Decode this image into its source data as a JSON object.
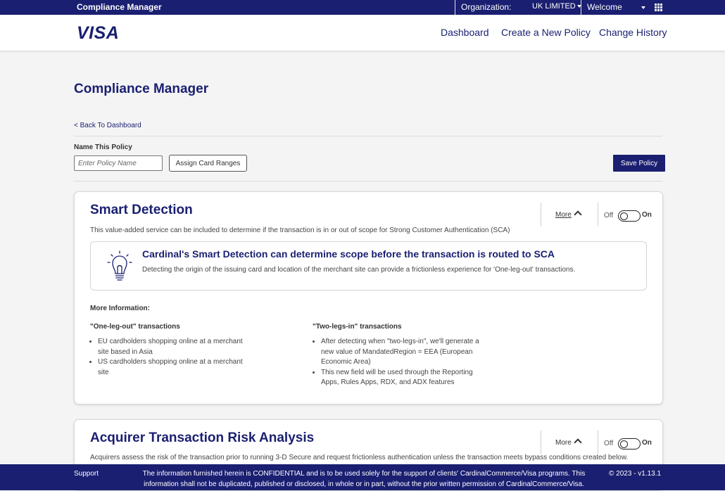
{
  "topbar": {
    "app_title": "Compliance Manager",
    "org_label": "Organization:",
    "org_value": "UK LIMITED",
    "welcome": "Welcome"
  },
  "header": {
    "logo": "VISA",
    "nav": [
      "Dashboard",
      "Create a New Policy",
      "Change History"
    ]
  },
  "page": {
    "title": "Compliance Manager",
    "back_link": "< Back To Dashboard",
    "name_label": "Name This Policy",
    "name_placeholder": "Enter Policy Name",
    "assign_button": "Assign Card Ranges",
    "save_button": "Save Policy"
  },
  "smart_detection": {
    "title": "Smart Detection",
    "description": "This value-added service can be included to determine if the transaction is in or out of scope for Strong Customer Authentication (SCA)",
    "more": "More",
    "toggle_off": "Off",
    "toggle_on": "On",
    "toggle_state": "off",
    "info_heading": "Cardinal's Smart Detection can determine scope before the transaction is routed to SCA",
    "info_text": "Detecting the origin of the issuing card and location of the merchant site can provide a frictionless experience for 'One-leg-out' transactions.",
    "more_info_title": "More Information:",
    "col1_title": "\"One-leg-out\" transactions",
    "col1_items": [
      "EU cardholders shopping online at a merchant site based in Asia",
      "US cardholders shopping online at a merchant site"
    ],
    "col2_title": "\"Two-legs-in\" transactions",
    "col2_items": [
      "After detecting when \"two-legs-in\", we'll generate a new value of MandatedRegion = EEA (European Economic Area)",
      "This new field will be used through the Reporting Apps, Rules Apps, RDX, and ADX features"
    ]
  },
  "tra": {
    "title": "Acquirer Transaction Risk Analysis",
    "description": "Acquirers assess the risk of the transaction prior to running 3-D Secure and request frictionless authentication unless the transaction meets bypass conditions created below.",
    "more": "More",
    "toggle_off": "Off",
    "toggle_on": "On",
    "toggle_state": "off"
  },
  "footer": {
    "support": "Support",
    "notice_line1": "The information furnished herein is CONFIDENTIAL and is to be used solely for the support of clients' CardinalCommerce/Visa programs. This",
    "notice_line2": "information shall not be duplicated, published or disclosed, in whole or in part, without the prior written permission of CardinalCommerce/Visa.",
    "version": "© 2023 - v1.13.1"
  },
  "colors": {
    "brand_navy": "#1a1f71",
    "page_bg": "#f4f4f4"
  },
  "icons": [
    "chevron-down-icon",
    "apps-grid-icon",
    "lightbulb-icon",
    "chevron-up-icon"
  ]
}
